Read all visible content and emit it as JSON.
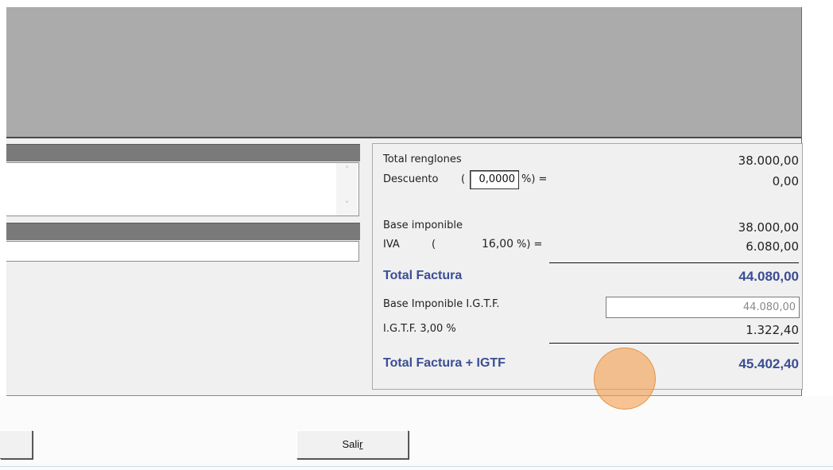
{
  "totals": {
    "total_renglones_label": "Total renglones",
    "total_renglones_value": "38.000,00",
    "descuento_label": "Descuento",
    "descuento_open": "(",
    "descuento_pct": "0,0000",
    "descuento_close": "%) =",
    "descuento_value": "0,00",
    "base_imponible_label": "Base imponible",
    "base_imponible_value": "38.000,00",
    "iva_label": "IVA",
    "iva_open": "(",
    "iva_pct": "16,00",
    "iva_close": "%) =",
    "iva_value": "6.080,00",
    "total_factura_label": "Total Factura",
    "total_factura_value": "44.080,00",
    "base_igtf_label": "Base Imponible I.G.T.F.",
    "base_igtf_value": "44.080,00",
    "igtf_label": "I.G.T.F. 3,00 %",
    "igtf_value": "1.322,40",
    "total_igtf_label": "Total Factura + IGTF",
    "total_igtf_value": "45.402,40"
  },
  "buttons": {
    "salir_prefix": "Sali",
    "salir_underlined": "r"
  },
  "scroll": {
    "up_icon": "chevron-up-icon",
    "down_icon": "chevron-down-icon"
  },
  "colors": {
    "total_blue": "#3b4d94",
    "click_indicator": "#f5a050"
  }
}
